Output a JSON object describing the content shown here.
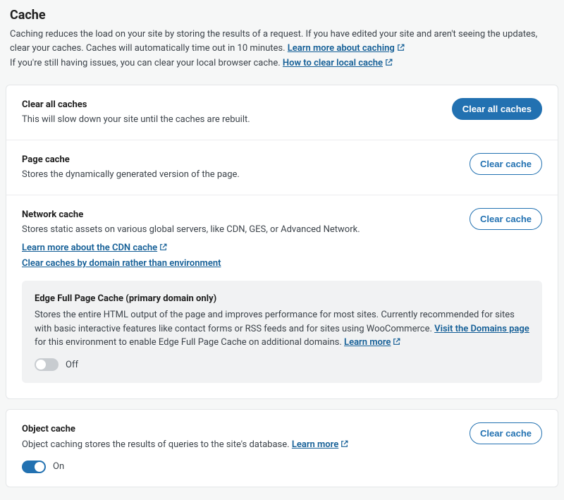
{
  "header": {
    "title": "Cache",
    "desc1": "Caching reduces the load on your site by storing the results of a request. If you have edited your site and aren't seeing the updates, clear your caches. Caches will automatically time out in 10 minutes.",
    "learn_more_caching": "Learn more about caching",
    "desc2": "If you're still having issues, you can clear your local browser cache.",
    "how_to_clear_local": "How to clear local cache"
  },
  "clear_all": {
    "title": "Clear all caches",
    "desc": "This will slow down your site until the caches are rebuilt.",
    "btn": "Clear all caches"
  },
  "page_cache": {
    "title": "Page cache",
    "desc": "Stores the dynamically generated version of the page.",
    "btn": "Clear cache"
  },
  "network_cache": {
    "title": "Network cache",
    "desc": "Stores static assets on various global servers, like CDN, GES, or Advanced Network.",
    "link_learn": "Learn more about the CDN cache",
    "link_domain": "Clear caches by domain rather than environment",
    "btn": "Clear cache"
  },
  "edge_fpc": {
    "title": "Edge Full Page Cache (primary domain only)",
    "desc_a": "Stores the entire HTML output of the page and improves performance for most sites. Currently recommended for sites with basic interactive features like contact forms or RSS feeds and for sites using WooCommerce.",
    "visit_domains": "Visit the Domains page",
    "desc_b": "for this environment to enable Edge Full Page Cache on additional domains.",
    "learn_more": "Learn more",
    "toggle_label": "Off"
  },
  "object_cache": {
    "title": "Object cache",
    "desc": "Object caching stores the results of queries to the site's database.",
    "learn_more": "Learn more",
    "btn": "Clear cache",
    "toggle_label": "On"
  }
}
